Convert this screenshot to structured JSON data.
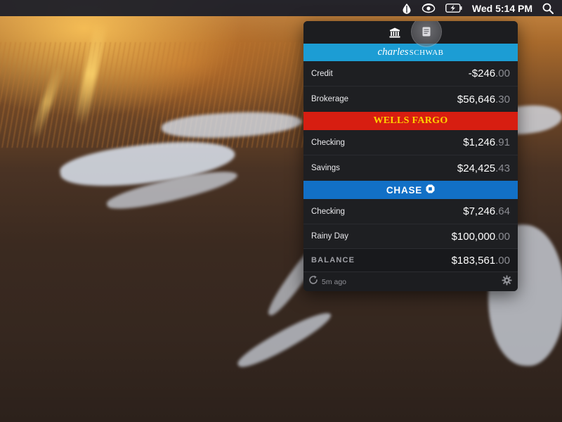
{
  "menubar": {
    "clock": "Wed 5:14 PM",
    "icons": [
      "drop-icon",
      "wifi-eye-icon",
      "battery-charging-icon",
      "search-icon"
    ]
  },
  "popover": {
    "toolbar": {
      "icons": [
        "bank-icon",
        "document-icon"
      ]
    },
    "banks": [
      {
        "name_script": "charles",
        "name_caps": "SCHWAB",
        "color": "#1c9dd4",
        "accounts": [
          {
            "label": "Credit",
            "amount_main": "-$246",
            "amount_cents": ".00"
          },
          {
            "label": "Brokerage",
            "amount_main": "$56,646",
            "amount_cents": ".30"
          }
        ]
      },
      {
        "name": "WELLS FARGO",
        "color": "#d71e11",
        "text_color": "#ffd200",
        "accounts": [
          {
            "label": "Checking",
            "amount_main": "$1,246",
            "amount_cents": ".91"
          },
          {
            "label": "Savings",
            "amount_main": "$24,425",
            "amount_cents": ".43"
          }
        ]
      },
      {
        "name": "CHASE",
        "color": "#1270c6",
        "accounts": [
          {
            "label": "Checking",
            "amount_main": "$7,246",
            "amount_cents": ".64"
          },
          {
            "label": "Rainy Day",
            "amount_main": "$100,000",
            "amount_cents": ".00"
          }
        ]
      }
    ],
    "balance": {
      "label": "BALANCE",
      "amount_main": "$183,561",
      "amount_cents": ".00"
    },
    "footer": {
      "updated": "5m ago"
    }
  }
}
